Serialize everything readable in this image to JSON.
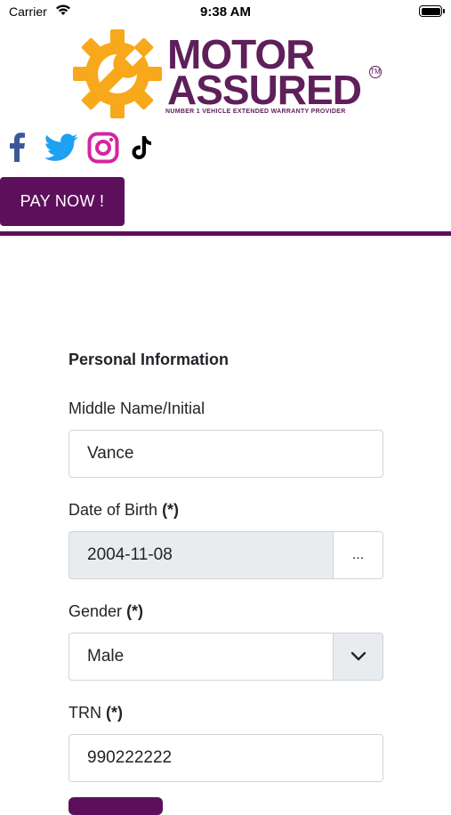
{
  "status_bar": {
    "carrier": "Carrier",
    "time": "9:38 AM"
  },
  "logo": {
    "line1": "MOTOR",
    "line2": "ASSURED",
    "tm": "TM",
    "tagline": "NUMBER 1 VEHICLE EXTENDED WARRANTY PROVIDER"
  },
  "social": [
    {
      "icon": "facebook-icon",
      "color": "#3b5998"
    },
    {
      "icon": "twitter-icon",
      "color": "#1da1f2"
    },
    {
      "icon": "instagram-icon",
      "color": "#d6249f"
    },
    {
      "icon": "tiktok-icon",
      "color": "#000000"
    }
  ],
  "pay_button": {
    "label": "PAY NOW !"
  },
  "colors": {
    "brand": "#5e0f5b",
    "accent": "#f7a81b"
  },
  "form": {
    "section_title": "Personal Information",
    "middle_name": {
      "label": "Middle Name/Initial",
      "value": "Vance"
    },
    "dob": {
      "label": "Date of Birth",
      "required": "(*)",
      "value": "2004-11-08",
      "button": "..."
    },
    "gender": {
      "label": "Gender",
      "required": "(*)",
      "value": "Male"
    },
    "trn": {
      "label": "TRN",
      "required": "(*)",
      "value": "990222222"
    }
  }
}
